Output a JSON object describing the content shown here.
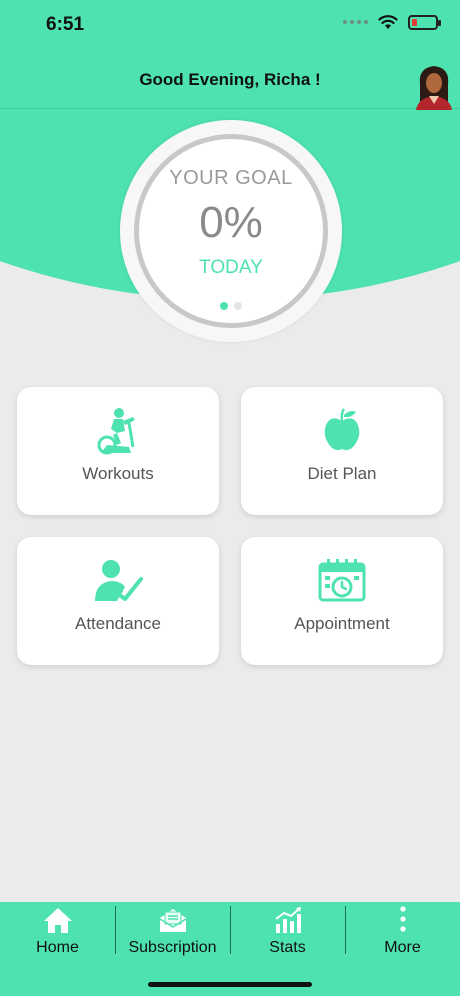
{
  "status": {
    "time": "6:51"
  },
  "header": {
    "greeting": "Good Evening, Richa !"
  },
  "goal": {
    "title": "YOUR GOAL",
    "percent": "0%",
    "period": "TODAY",
    "progress": 0.0
  },
  "tiles": [
    {
      "label": "Workouts",
      "icon": "exercise-bike-icon"
    },
    {
      "label": "Diet Plan",
      "icon": "apple-icon"
    },
    {
      "label": "Attendance",
      "icon": "attendance-check-icon"
    },
    {
      "label": "Appointment",
      "icon": "calendar-clock-icon"
    }
  ],
  "nav": [
    {
      "label": "Home",
      "icon": "home-icon"
    },
    {
      "label": "Subscription",
      "icon": "subscription-mail-icon"
    },
    {
      "label": "Stats",
      "icon": "stats-chart-icon"
    },
    {
      "label": "More",
      "icon": "more-dots-icon"
    }
  ],
  "colors": {
    "accent": "#4de2b0",
    "background": "#ebebeb",
    "text": "#555555"
  }
}
